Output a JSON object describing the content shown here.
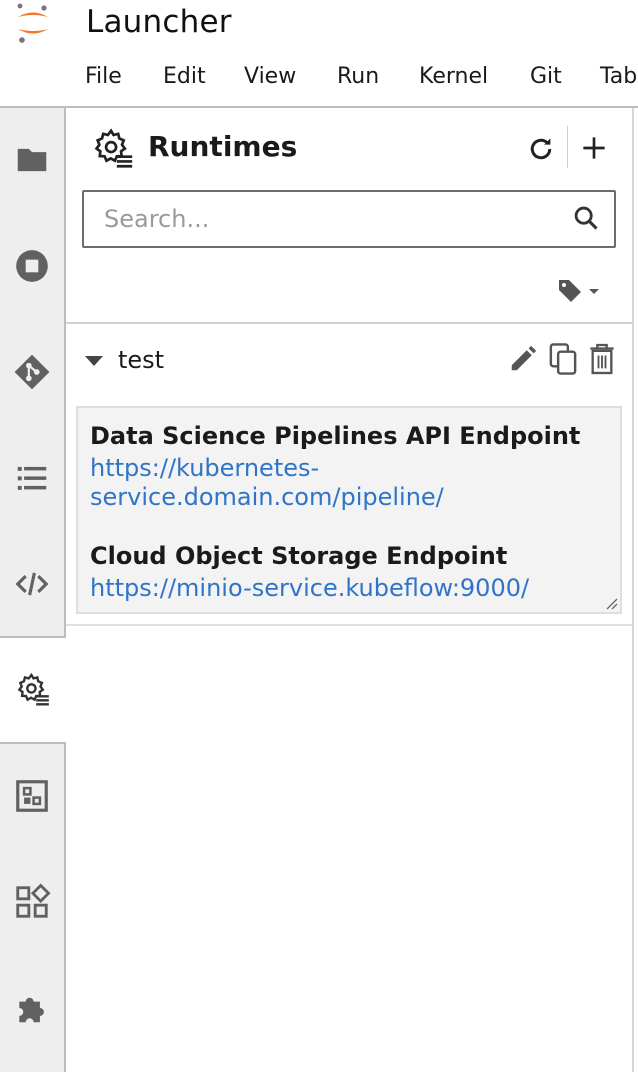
{
  "app": {
    "title": "Launcher"
  },
  "menu": [
    "File",
    "Edit",
    "View",
    "Run",
    "Kernel",
    "Git",
    "Tab"
  ],
  "sidebar": {
    "items": [
      {
        "icon": "folder-icon",
        "name": "file-browser"
      },
      {
        "icon": "stop-circle-icon",
        "name": "running-sessions"
      },
      {
        "icon": "git-icon",
        "name": "git"
      },
      {
        "icon": "list-icon",
        "name": "table-of-contents"
      },
      {
        "icon": "code-icon",
        "name": "code-snippets"
      },
      {
        "icon": "runtimes-gear-icon",
        "name": "runtimes",
        "active": true
      },
      {
        "icon": "runtime-images-icon",
        "name": "runtime-images"
      },
      {
        "icon": "component-catalog-icon",
        "name": "component-catalogs"
      },
      {
        "icon": "puzzle-icon",
        "name": "extensions"
      }
    ]
  },
  "panel": {
    "title": "Runtimes",
    "search": {
      "placeholder": "Search...",
      "value": ""
    },
    "runtimes": [
      {
        "name": "test",
        "expanded": true,
        "details": [
          {
            "label": "Data Science Pipelines API Endpoint",
            "value": "https://kubernetes-service.domain.com/pipeline/"
          },
          {
            "label": "Cloud Object Storage Endpoint",
            "value": "https://minio-service.kubeflow:9000/"
          }
        ]
      }
    ]
  },
  "colors": {
    "link": "#2f74c8",
    "accent_logo": "#f37726",
    "sidebar_bg": "#eeeeee"
  }
}
